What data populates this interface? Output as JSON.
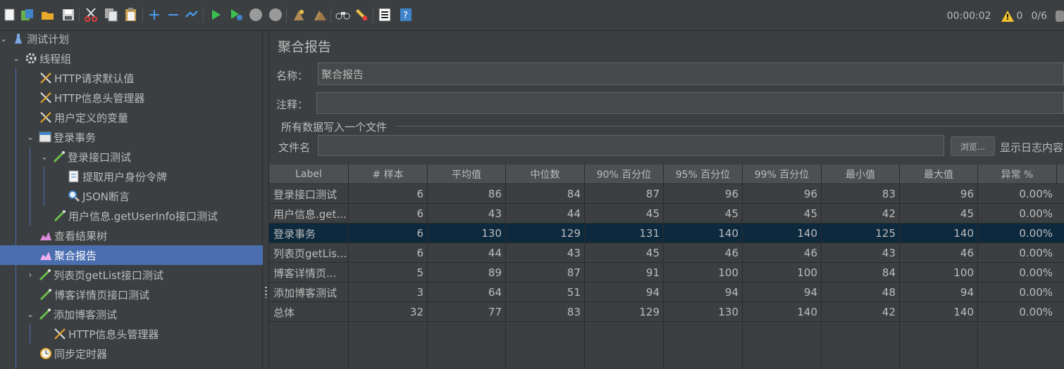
{
  "toolbar": {
    "icons": [
      "new-plan-icon",
      "templates-icon",
      "open-icon",
      "save-icon",
      "cut-icon",
      "copy-icon",
      "paste-icon",
      "expand-icon",
      "collapse-icon",
      "toggle-icon",
      "start-icon",
      "start-no-pause-icon",
      "stop-icon",
      "shutdown-icon",
      "clear-icon",
      "clear-all-icon",
      "search-icon",
      "reset-search-icon",
      "function-helper-icon",
      "help-icon"
    ],
    "elapsed": "00:00:02",
    "warnings": "0",
    "threads": "0/6"
  },
  "tree": {
    "items": [
      {
        "label": "测试计划",
        "icon": "test-plan-icon"
      },
      {
        "label": "线程组",
        "icon": "thread-group-icon"
      },
      {
        "label": "HTTP请求默认值",
        "icon": "config-element-icon"
      },
      {
        "label": "HTTP信息头管理器",
        "icon": "config-element-icon"
      },
      {
        "label": "用户定义的变量",
        "icon": "config-element-icon"
      },
      {
        "label": "登录事务",
        "icon": "transaction-controller-icon"
      },
      {
        "label": "登录接口测试",
        "icon": "sampler-icon"
      },
      {
        "label": "提取用户身份令牌",
        "icon": "post-processor-icon"
      },
      {
        "label": "JSON断言",
        "icon": "assertion-icon"
      },
      {
        "label": "用户信息.getUserInfo接口测试",
        "icon": "sampler-icon"
      },
      {
        "label": "查看结果树",
        "icon": "listener-icon"
      },
      {
        "label": "聚合报告",
        "icon": "listener-icon"
      },
      {
        "label": "列表页getList接口测试",
        "icon": "sampler-icon"
      },
      {
        "label": "博客详情页接口测试",
        "icon": "sampler-icon"
      },
      {
        "label": "添加博客测试",
        "icon": "sampler-icon"
      },
      {
        "label": "HTTP信息头管理器",
        "icon": "config-element-icon"
      },
      {
        "label": "同步定时器",
        "icon": "timer-icon"
      }
    ]
  },
  "panel": {
    "title": "聚合报告",
    "name_label": "名称：",
    "name_value": "聚合报告",
    "comment_label": "注释：",
    "comment_value": "",
    "file_group_label": "所有数据写入一个文件",
    "filename_label": "文件名",
    "filename_value": "",
    "browse_label": "浏览...",
    "log_label": "显示日志内容"
  },
  "table": {
    "headers": [
      "Label",
      "# 样本",
      "平均值",
      "中位数",
      "90% 百分位",
      "95% 百分位",
      "99% 百分位",
      "最小值",
      "最大值",
      "异常 %"
    ],
    "rows": [
      [
        "登录接口测试",
        "6",
        "86",
        "84",
        "87",
        "96",
        "96",
        "83",
        "96",
        "0.00%"
      ],
      [
        "用户信息.get...",
        "6",
        "43",
        "44",
        "45",
        "45",
        "45",
        "42",
        "45",
        "0.00%"
      ],
      [
        "登录事务",
        "6",
        "130",
        "129",
        "131",
        "140",
        "140",
        "125",
        "140",
        "0.00%"
      ],
      [
        "列表页getLis...",
        "6",
        "44",
        "43",
        "45",
        "46",
        "46",
        "43",
        "46",
        "0.00%"
      ],
      [
        "博客详情页...",
        "5",
        "89",
        "87",
        "91",
        "100",
        "100",
        "84",
        "100",
        "0.00%"
      ],
      [
        "添加博客测试",
        "3",
        "64",
        "51",
        "94",
        "94",
        "94",
        "48",
        "94",
        "0.00%"
      ],
      [
        "总体",
        "32",
        "77",
        "83",
        "129",
        "130",
        "140",
        "42",
        "140",
        "0.00%"
      ]
    ],
    "selected_row": 2
  },
  "colors": {
    "background": "#3c3f41",
    "tree_selection": "#4b6eaf",
    "table_selection": "#0d293e",
    "warning": "#f2c12e"
  }
}
